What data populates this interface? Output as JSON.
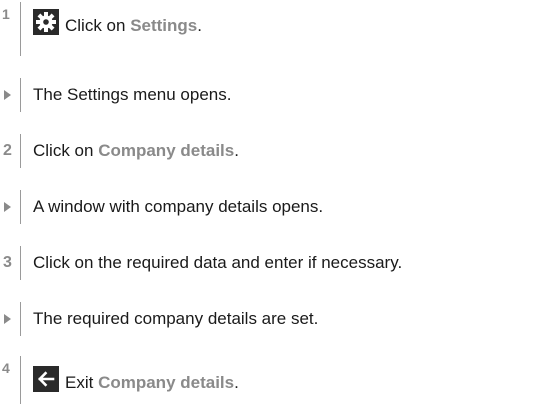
{
  "steps": [
    {
      "marker": "1",
      "icon": "gear-icon",
      "pre": "Click on ",
      "highlight": "Settings",
      "post": "."
    },
    {
      "marker": "arrow",
      "text": "The Settings menu opens."
    },
    {
      "marker": "2",
      "pre": "Click on ",
      "highlight": "Company details",
      "post": "."
    },
    {
      "marker": "arrow",
      "text": "A window with company details opens."
    },
    {
      "marker": "3",
      "text": "Click on the required data and enter if necessary."
    },
    {
      "marker": "arrow",
      "text": "The required company details are set."
    },
    {
      "marker": "4",
      "icon": "back-arrow-icon",
      "pre": "Exit ",
      "highlight": "Company details",
      "post": "."
    }
  ],
  "colors": {
    "highlight": "#8a8a8a",
    "text": "#1a1a1a",
    "icon_bg": "#2a2a2a"
  }
}
